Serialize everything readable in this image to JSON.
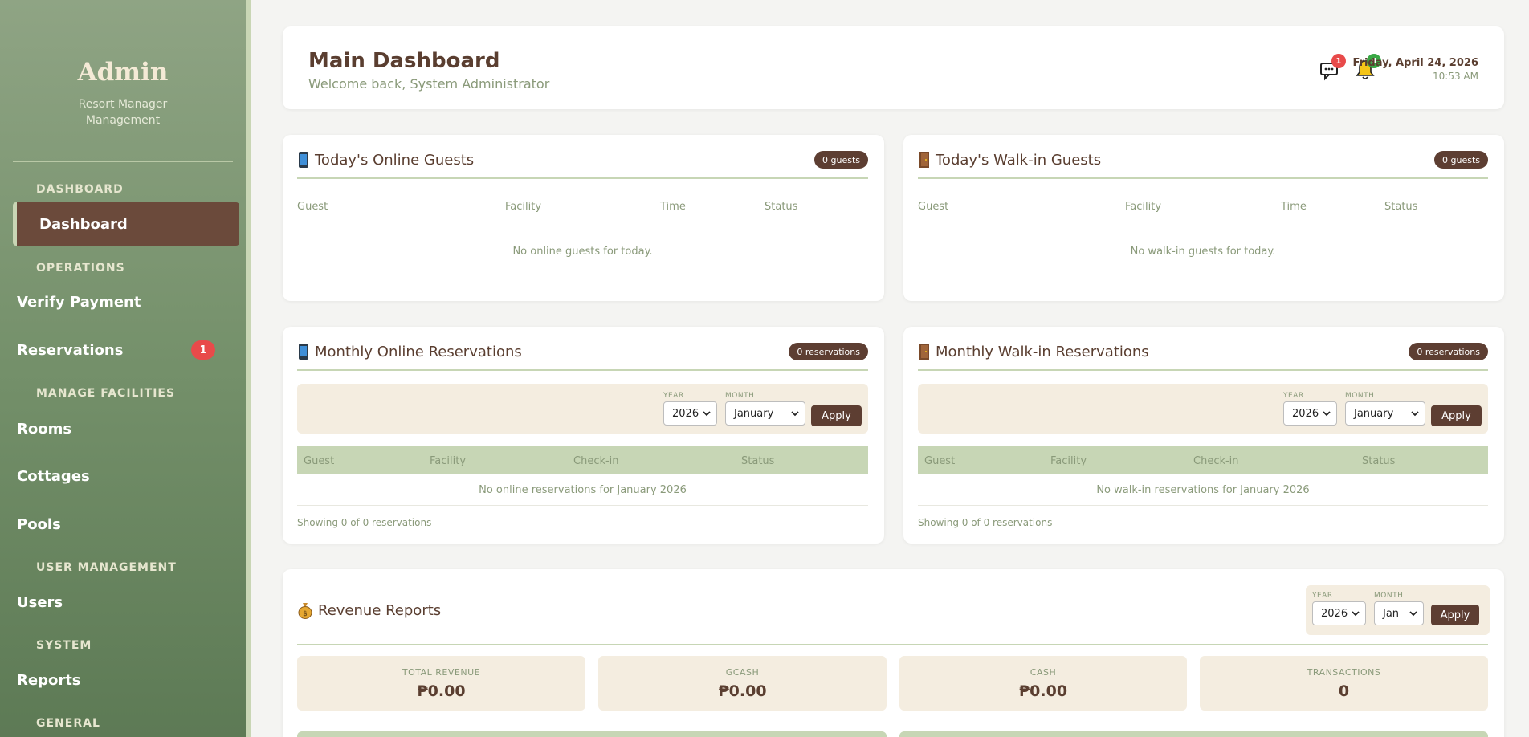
{
  "sidebar": {
    "title": "Admin",
    "subtitle": "Resort Manager Management",
    "sections": {
      "dashboard": "DASHBOARD",
      "operations": "OPERATIONS",
      "facilities": "MANAGE FACILITIES",
      "users": "USER MANAGEMENT",
      "system": "SYSTEM",
      "general": "GENERAL"
    },
    "items": {
      "dashboard": "Dashboard",
      "verify_payment": "Verify Payment",
      "reservations": "Reservations",
      "reservations_badge": "1",
      "rooms": "Rooms",
      "cottages": "Cottages",
      "pools": "Pools",
      "users": "Users",
      "reports": "Reports"
    }
  },
  "header": {
    "title": "Main Dashboard",
    "subtitle": "Welcome back, System Administrator",
    "messages_badge": "1",
    "notifications_badge": "4",
    "date": "Friday, April 24, 2026",
    "time": "10:53 AM"
  },
  "online_guests": {
    "title": "Today's Online Guests",
    "count": "0 guests",
    "columns": [
      "Guest",
      "Facility",
      "Time",
      "Status"
    ],
    "empty": "No online guests for today."
  },
  "walkin_guests": {
    "title": "Today's Walk-in Guests",
    "count": "0 guests",
    "columns": [
      "Guest",
      "Facility",
      "Time",
      "Status"
    ],
    "empty": "No walk-in guests for today."
  },
  "online_reservations": {
    "title": "Monthly Online Reservations",
    "count": "0 reservations",
    "year_label": "YEAR",
    "month_label": "MONTH",
    "year": "2026",
    "month": "January",
    "apply": "Apply",
    "columns": [
      "Guest",
      "Facility",
      "Check-in",
      "Status"
    ],
    "empty": "No online reservations for January 2026",
    "showing": "Showing 0 of 0 reservations"
  },
  "walkin_reservations": {
    "title": "Monthly Walk-in Reservations",
    "count": "0 reservations",
    "year_label": "YEAR",
    "month_label": "MONTH",
    "year": "2026",
    "month": "January",
    "apply": "Apply",
    "columns": [
      "Guest",
      "Facility",
      "Check-in",
      "Status"
    ],
    "empty": "No walk-in reservations for January 2026",
    "showing": "Showing 0 of 0 reservations"
  },
  "revenue": {
    "title": "Revenue Reports",
    "year_label": "YEAR",
    "month_label": "MONTH",
    "year": "2026",
    "month": "Jan",
    "apply": "Apply",
    "stats": [
      {
        "label": "TOTAL REVENUE",
        "value": "₱0.00"
      },
      {
        "label": "GCASH",
        "value": "₱0.00"
      },
      {
        "label": "CASH",
        "value": "₱0.00"
      },
      {
        "label": "TRANSACTIONS",
        "value": "0"
      }
    ]
  },
  "colors": {
    "accent_brown": "#5d3e32",
    "sage": "#c7d6b5",
    "badge_red": "#e84a4a",
    "badge_green": "#3aa845"
  }
}
